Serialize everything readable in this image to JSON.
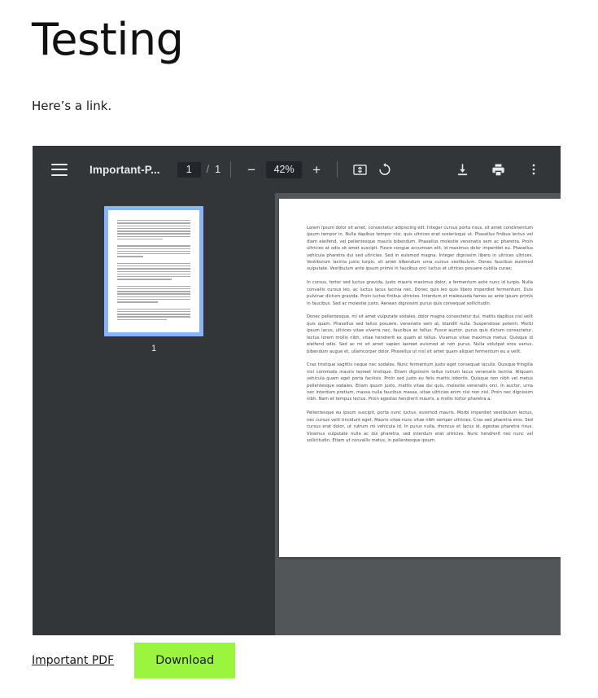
{
  "page": {
    "title": "Testing",
    "intro": "Here’s a link."
  },
  "pdf_viewer": {
    "toolbar": {
      "menu_icon": "hamburger-menu-icon",
      "document_title": "Important-P...",
      "current_page": "1",
      "page_separator": "/",
      "total_pages": "1",
      "zoom_out_label": "−",
      "zoom_level": "42%",
      "zoom_in_label": "+",
      "fit_icon": "fit-to-page-icon",
      "rotate_icon": "rotate-counterclockwise-icon",
      "download_icon": "download-icon",
      "print_icon": "print-icon",
      "more_icon": "more-vertical-icon"
    },
    "thumbnails": [
      {
        "label": "1",
        "selected": true
      }
    ],
    "document": {
      "paragraphs": [
        "Lorem ipsum dolor sit amet, consectetur adipiscing elit. Integer cursus porta risus, sit amet condimentum ipsum tempor in. Nulla dapibus tempor nisi, quis ultrices erat scelerisque ut. Phasellus finibus lectus vel diam eleifend, vel pellentesque mauris bibendum. Phasellus molestie venenatis sem ac pharetra. Proin ultricies at odio sit amet suscipit. Fusce congue accumsan elit, id maximus dolor imperdiet eu. Phasellus vehicula pharetra dui sed ultricies. Sed in euismod magna. Integer dignissim libero in ultrices ultrices. Vestibulum lacinia justo turpis, sit amet bibendum urna cursus vestibulum. Donec faucibus euismod vulputate. Vestibulum ante ipsum primis in faucibus orci luctus et ultrices posuere cubilia curae;",
        "In cursus, tortor sed luctus gravida, justo mauris maximus dolor, a fermentum ante nunc id turpis. Nulla convallis cursus leo, ac luctus lacus lacinia nec. Donec quis leo quis libero imperdiet fermentum. Duis pulvinar dictum gravida. Proin luctus finibus ultricies. Interdum et malesuada fames ac ante ipsum primis in faucibus. Sed ac molestie justo. Aenean dignissim purus quis consequat sollicitudin.",
        "Donec pellentesque, mi sit amet vulputate sodales, dolor magna consectetur dui, mattis dapibus nisi velit quis quam. Phasellus sed tellus posuere, venenatis sem at, blandit nulla. Suspendisse potenti. Morbi ipsum lacus, ultrices vitae viverra nec, faucibus ac tellus. Fusce auctor, purus quis dictum consectetur, lectus lorem mollis nibh, vitae hendrerit ex quam at tellus. Vivamus vitae maximus metus. Quisque id eleifend odio. Sed ac mi sit amet sapien laoreet euismod at non purus. Nulla volutpat eros varius, bibendum augue et, ullamcorper dolor. Phasellus ut nisl sit amet quam aliquet fermentum eu a velit.",
        "Cras tristique sagittis neque nec sodales. Nunc fermentum justo eget consequat iaculis. Quisque fringilla nisl commodo mauris laoreet tristique. Etiam dignissim tellus rutrum lacus venenatis lacinia. Aliquam vehicula quam eget porta facilisis. Proin sed justo eu felis mattis lobortis. Quisque non nibh vel metus pellentesque sodales. Etiam ipsum justo, mattis vitae dui quis, molestie venenatis orci. In auctor, urna nec interdum pretium, massa nulla faucibus massa, vitae ultricies enim nisi non nisl. Proin nec dignissim nibh. Nam et tempus lectus. Proin egestas hendrerit mauris, a mollis tortor pharetra a.",
        "Pellentesque eu ipsum suscipit, porta nunc luctus, euismod mauris. Morbi imperdiet vestibulum lectus, nec cursus velit tincidunt eget. Mauris vitae nunc vitae nibh semper ultricies. Cras sed pharetra eros. Sed cursus erat dolor, ut rutrum mi vehicula id. In purus nulla, rhoncus et lacus id, egestas pharetra risus. Vivamus vulputate nulla ac dui pharetra, sed interdum erat ultricies. Nunc hendrerit nec nunc vel sollicitudin. Etiam ut convallis metus, in pellentesque ipsum."
      ]
    }
  },
  "footer": {
    "link_label": "Important PDF",
    "download_label": "Download"
  },
  "colors": {
    "toolbar_bg": "#323639",
    "viewer_bg": "#525659",
    "thumbnail_selected": "#8ab4f8",
    "download_button": "#9bf53f",
    "toolbar_text": "#e8eaed",
    "input_bg": "#22262a"
  }
}
